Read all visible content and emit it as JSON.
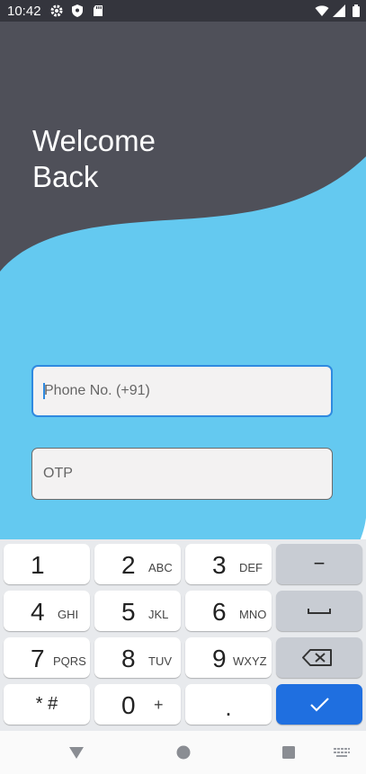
{
  "status_bar": {
    "time": "10:42",
    "icons_left": [
      "gear-icon",
      "shield-icon",
      "sd-card-icon"
    ],
    "icons_right": [
      "wifi-icon",
      "signal-icon",
      "battery-icon"
    ]
  },
  "colors": {
    "dark_panel": "#4f5059",
    "accent_blue": "#64c9f0",
    "status_bar": "#34353d",
    "focus_border": "#2f8ae0",
    "done_key": "#1f6fe0"
  },
  "hero": {
    "welcome_line1": "Welcome",
    "welcome_line2": "Back"
  },
  "form": {
    "phone_placeholder": "Phone No. (+91)",
    "phone_value": "",
    "otp_placeholder": "OTP",
    "otp_value": ""
  },
  "keyboard": {
    "k1": {
      "num": "1",
      "sub": ""
    },
    "k2": {
      "num": "2",
      "sub": "ABC"
    },
    "k3": {
      "num": "3",
      "sub": "DEF"
    },
    "k4": {
      "num": "4",
      "sub": "GHI"
    },
    "k5": {
      "num": "5",
      "sub": "JKL"
    },
    "k6": {
      "num": "6",
      "sub": "MNO"
    },
    "k7": {
      "num": "7",
      "sub": "PQRS"
    },
    "k8": {
      "num": "8",
      "sub": "TUV"
    },
    "k9": {
      "num": "9",
      "sub": "WXYZ"
    },
    "k0": {
      "num": "0",
      "sub": "+"
    },
    "star_hash": "* #",
    "dot": ".",
    "minus": "−"
  },
  "navbar": {
    "icons": [
      "back-icon",
      "home-icon",
      "recents-icon",
      "keyboard-switch-icon"
    ]
  }
}
